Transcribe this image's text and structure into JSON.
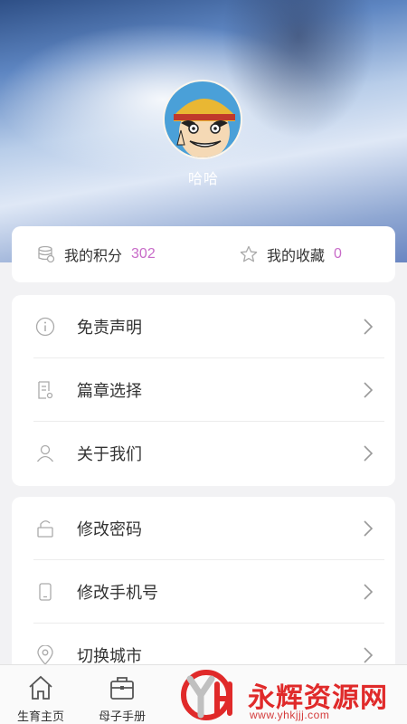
{
  "profile": {
    "username": "哈哈"
  },
  "stats": [
    {
      "label": "我的积分",
      "value": "302",
      "icon": "coins-icon"
    },
    {
      "label": "我的收藏",
      "value": "0",
      "icon": "star-icon"
    }
  ],
  "menu_group_1": [
    {
      "label": "免责声明",
      "icon": "info-icon"
    },
    {
      "label": "篇章选择",
      "icon": "document-icon"
    },
    {
      "label": "关于我们",
      "icon": "user-icon"
    }
  ],
  "menu_group_2": [
    {
      "label": "修改密码",
      "icon": "lock-icon"
    },
    {
      "label": "修改手机号",
      "icon": "phone-icon"
    },
    {
      "label": "切换城市",
      "icon": "location-icon"
    }
  ],
  "tabbar": [
    {
      "label": "生育主页",
      "icon": "home-icon"
    },
    {
      "label": "母子手册",
      "icon": "briefcase-icon"
    }
  ],
  "watermark": {
    "text": "永辉资源网",
    "url": "www.yhkjjj.com"
  },
  "colors": {
    "accent": "#c86bc8",
    "watermark": "#e02a2a"
  }
}
